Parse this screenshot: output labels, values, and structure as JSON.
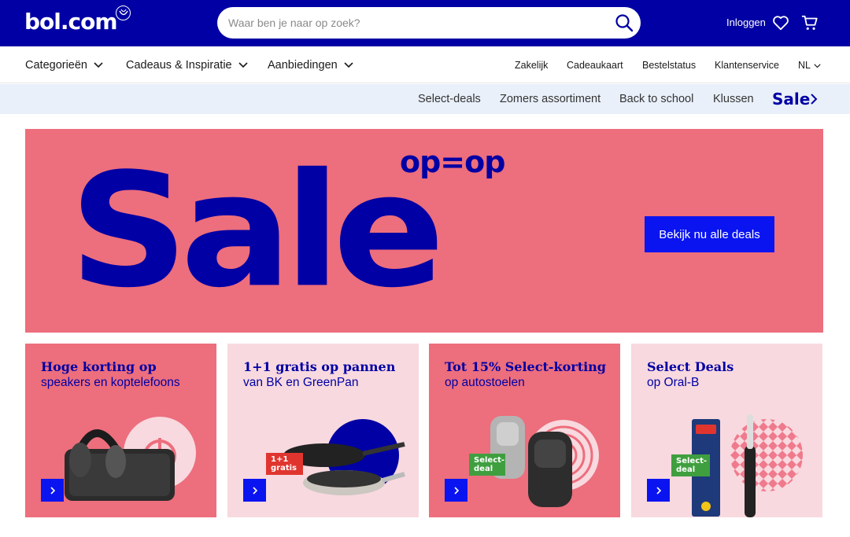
{
  "header": {
    "logo": "bol.com",
    "search_placeholder": "Waar ben je naar op zoek?",
    "login_label": "Inloggen",
    "icons": [
      "search-icon",
      "heart-icon",
      "cart-icon"
    ]
  },
  "nav": {
    "left": [
      "Categorieën",
      "Cadeaus & Inspiratie",
      "Aanbiedingen"
    ],
    "right": [
      "Zakelijk",
      "Cadeaukaart",
      "Bestelstatus",
      "Klantenservice",
      "NL"
    ]
  },
  "subnav": {
    "items": [
      "Select-deals",
      "Zomers assortiment",
      "Back to school",
      "Klussen"
    ],
    "sale": "Sale"
  },
  "hero": {
    "big_text": "Sale",
    "small_text": "op=op",
    "button_label": "Bekijk nu alle deals"
  },
  "cards": [
    {
      "title": "Hoge korting op",
      "subtitle": "speakers en koptelefoons",
      "badge": ""
    },
    {
      "title": "1+1 gratis op pannen",
      "subtitle": "van BK en GreenPan",
      "badge": "1+1 gratis"
    },
    {
      "title": "Tot 15% Select-korting",
      "subtitle": "op autostoelen",
      "badge": "Select-deal"
    },
    {
      "title": "Select Deals",
      "subtitle": "op Oral-B",
      "badge": "Select-deal"
    }
  ],
  "colors": {
    "brand_blue": "#0000a4",
    "button_blue": "#0a14f0",
    "sale_pink": "#ed6e7c",
    "light_pink": "#f8d9df",
    "select_green": "#3f9f3f",
    "promo_red": "#e0352f"
  }
}
